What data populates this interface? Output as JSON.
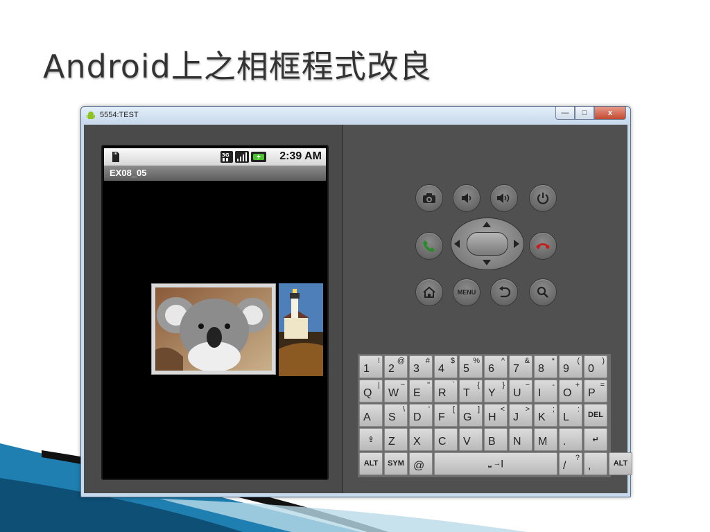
{
  "slide": {
    "title": "Android上之相框程式改良"
  },
  "window": {
    "title": "5554:TEST",
    "controls": {
      "minimize": "—",
      "maximize": "□",
      "close": "x"
    }
  },
  "phone": {
    "clock": "2:39 AM",
    "app_title": "EX08_05",
    "status_icons": [
      "sd-card-icon",
      "3g-icon",
      "signal-icon",
      "battery-charging-icon"
    ],
    "gallery_images": [
      "koala-photo",
      "lighthouse-photo"
    ]
  },
  "controls": {
    "menu_label": "MENU",
    "buttons": [
      "camera-icon",
      "volume-down-icon",
      "volume-up-icon",
      "power-icon",
      "call-icon",
      "end-call-icon",
      "home-icon",
      "menu",
      "back-icon",
      "search-icon"
    ]
  },
  "keyboard": {
    "rows": [
      [
        {
          "m": "1",
          "a": "!"
        },
        {
          "m": "2",
          "a": "@"
        },
        {
          "m": "3",
          "a": "#"
        },
        {
          "m": "4",
          "a": "$"
        },
        {
          "m": "5",
          "a": "%"
        },
        {
          "m": "6",
          "a": "^"
        },
        {
          "m": "7",
          "a": "&"
        },
        {
          "m": "8",
          "a": "*"
        },
        {
          "m": "9",
          "a": "("
        },
        {
          "m": "0",
          "a": ")"
        }
      ],
      [
        {
          "m": "Q",
          "a": "|"
        },
        {
          "m": "W",
          "a": "~"
        },
        {
          "m": "E",
          "a": "\""
        },
        {
          "m": "R",
          "a": "`"
        },
        {
          "m": "T",
          "a": "{"
        },
        {
          "m": "Y",
          "a": "}"
        },
        {
          "m": "U",
          "a": "−"
        },
        {
          "m": "I",
          "a": "-"
        },
        {
          "m": "O",
          "a": "+"
        },
        {
          "m": "P",
          "a": "="
        }
      ],
      [
        {
          "m": "A",
          "a": ""
        },
        {
          "m": "S",
          "a": "\\"
        },
        {
          "m": "D",
          "a": "'"
        },
        {
          "m": "F",
          "a": "["
        },
        {
          "m": "G",
          "a": "]"
        },
        {
          "m": "H",
          "a": "<"
        },
        {
          "m": "J",
          "a": ">"
        },
        {
          "m": "K",
          "a": ";"
        },
        {
          "m": "L",
          "a": ":"
        },
        {
          "c": "DEL"
        }
      ],
      [
        {
          "c": "⇪"
        },
        {
          "m": "Z",
          "a": ""
        },
        {
          "m": "X",
          "a": ""
        },
        {
          "m": "C",
          "a": ""
        },
        {
          "m": "V",
          "a": ""
        },
        {
          "m": "B",
          "a": ""
        },
        {
          "m": "N",
          "a": ""
        },
        {
          "m": "M",
          "a": ""
        },
        {
          "m": ".",
          "a": ""
        },
        {
          "c": "↵"
        }
      ],
      [
        {
          "c": "ALT"
        },
        {
          "c": "SYM"
        },
        {
          "m": "@",
          "a": ""
        },
        {
          "c": "⎵ →|",
          "w": "space"
        },
        {
          "m": "/",
          "a": "?"
        },
        {
          "m": ",",
          "a": ""
        },
        {
          "c": "ALT"
        }
      ]
    ]
  }
}
